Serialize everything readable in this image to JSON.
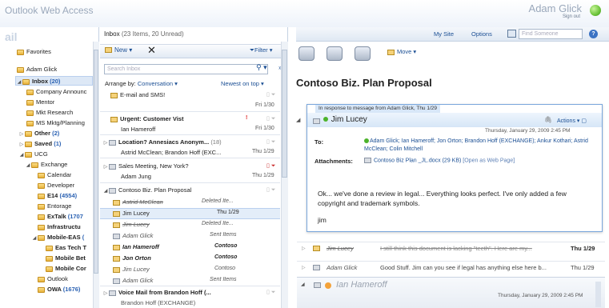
{
  "header": {
    "app_title": "Outlook Web Access",
    "user_name": "Adam Glick",
    "sign_out": "Sign out",
    "my_site": "My Site",
    "options": "Options",
    "find_placeholder": "Find Someone",
    "help": "?"
  },
  "nav": {
    "header": "ail",
    "items": [
      {
        "label": "Favorites",
        "count": ""
      },
      {
        "label": "Adam Glick",
        "count": ""
      },
      {
        "label": "Inbox",
        "count": "(20)"
      },
      {
        "label": "Company Announc",
        "count": ""
      },
      {
        "label": "Mentor",
        "count": ""
      },
      {
        "label": "Mkt Research",
        "count": ""
      },
      {
        "label": "MS Mktg/Planning",
        "count": ""
      },
      {
        "label": "Other",
        "count": "(2)"
      },
      {
        "label": "Saved",
        "count": "(1)"
      },
      {
        "label": "UCG",
        "count": ""
      },
      {
        "label": "Exchange",
        "count": ""
      },
      {
        "label": "Calendar",
        "count": ""
      },
      {
        "label": "Developer",
        "count": ""
      },
      {
        "label": "E14",
        "count": "(4554)"
      },
      {
        "label": "Entorage",
        "count": ""
      },
      {
        "label": "ExTalk",
        "count": "(1707"
      },
      {
        "label": "Infrastructu",
        "count": ""
      },
      {
        "label": "Mobile-EAS",
        "count": "("
      },
      {
        "label": "Eas Tech T",
        "count": ""
      },
      {
        "label": "Mobile Bet",
        "count": ""
      },
      {
        "label": "Mobile Cor",
        "count": ""
      },
      {
        "label": "Outlook",
        "count": ""
      },
      {
        "label": "OWA",
        "count": "(1676)"
      }
    ]
  },
  "list": {
    "folder": "Inbox",
    "folder_info": "(23 Items, 20 Unread)",
    "new_label": "New",
    "delete": "✕",
    "filter_label": "Filter",
    "search_placeholder": "Search Inbox",
    "arrange_by": "Arrange by:",
    "arrange_value": "Conversation",
    "sort": "Newest on top",
    "messages": [
      {
        "title": "E-mail and SMS!",
        "from": "",
        "time": "Fri 1/30"
      },
      {
        "title": "Urgent: Customer Vist",
        "from": "Ian Hameroff",
        "time": "Fri 1/30",
        "important": "!"
      },
      {
        "title": "Location? Annesiacs Anonym...",
        "count": "(18)",
        "from": "Astrid McClean; Brandon Hoff (EXC...",
        "time": "Thu 1/29"
      },
      {
        "title": "Sales Meeting, New York?",
        "from": "Adam Jung",
        "time": "Thu 1/29"
      },
      {
        "title": "Contoso Biz. Plan Proposal",
        "from": "",
        "time": ""
      },
      {
        "title": "Astrid McClean",
        "folder": "Deleted Ite...",
        "kind": "strike"
      },
      {
        "title": "Jim Lucey",
        "folder": "Thu 1/29",
        "kind": "selected"
      },
      {
        "title": "Jim Lucey",
        "folder": "Deleted Ite...",
        "kind": "strike"
      },
      {
        "title": "Adam Glick",
        "folder": "Sent Items",
        "kind": "it"
      },
      {
        "title": "Ian Hameroff",
        "folder": "Contoso",
        "kind": "it"
      },
      {
        "title": "Jon Orton",
        "folder": "Contoso",
        "kind": "it"
      },
      {
        "title": "Jim Lucey",
        "folder": "Contoso",
        "kind": "it"
      },
      {
        "title": "Adam Glick",
        "folder": "Sent Items",
        "kind": "it"
      },
      {
        "title": "Voice Mail from Brandon Hoff (...",
        "from": "Brandon Hoff (EXCHANGE)",
        "time": ""
      }
    ]
  },
  "reading": {
    "move_label": "Move",
    "subject": "Contoso Biz. Plan Proposal",
    "in_response": "In response to message from Adam Glick, Thu 1/29",
    "sender": "Jim Lucey",
    "actions": "Actions",
    "date": "Thursday, January 29, 2009 2:45 PM",
    "to_label": "To:",
    "to_value": "Adam Glick; Ian Hameroff; Jon Orton; Brandon Hoff (EXCHANGE); Ankur Kothari; Astrid McClean; Colin Mitchell",
    "attachments_label": "Attachments:",
    "attachment": "Contoso Biz Plan _JL.docx (29 KB)",
    "attachment_web": "[Open as Web Page]",
    "body": "Ok... we've done a review in legal... Everything looks perfect. I've only added a few copyright and trademark symbols.",
    "signature": "jim",
    "thread": [
      {
        "from": "Jim Lucey",
        "preview": "I still think this document is lacking \"teeth\". Here are my...",
        "time": "Thu 1/29"
      },
      {
        "from": "Adam Glick",
        "preview": "Good Stuff. Jim can you see if legal has anything else here b...",
        "time": "Thu 1/29"
      }
    ],
    "last_from": "Ian Hameroff",
    "last_date": "Thursday, January 29, 2009 2:45 PM"
  },
  "colors": {
    "link": "#1b4f94",
    "accent": "#7aa7dc",
    "presence": "#6cc43a"
  }
}
